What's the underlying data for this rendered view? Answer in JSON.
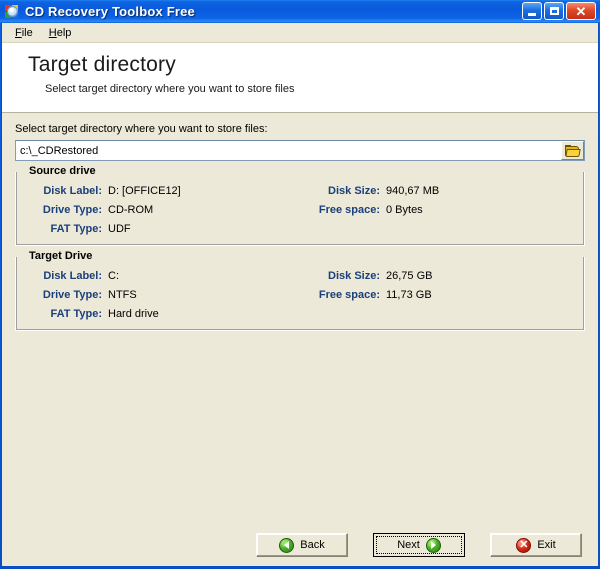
{
  "window": {
    "title": "CD Recovery Toolbox Free",
    "icon": "cd-disc-icon",
    "controls": {
      "minimize": "minimize-icon",
      "maximize": "maximize-icon",
      "close": "✕"
    }
  },
  "menu": {
    "items": [
      {
        "accel": "F",
        "rest": "ile"
      },
      {
        "accel": "H",
        "rest": "elp"
      }
    ]
  },
  "header": {
    "title": "Target directory",
    "subtitle": "Select target directory where you want to store files"
  },
  "path_field": {
    "label": "Select target directory where you want to store files:",
    "value": "c:\\_CDRestored",
    "placeholder": "",
    "browse_icon": "folder-open-icon"
  },
  "source_drive": {
    "title": "Source drive",
    "left": [
      {
        "key": "Disk Label:",
        "value": "D: [OFFICE12]"
      },
      {
        "key": "Drive Type:",
        "value": "CD-ROM"
      },
      {
        "key": "FAT Type:",
        "value": "UDF"
      }
    ],
    "right": [
      {
        "key": "Disk Size:",
        "value": "940,67 MB"
      },
      {
        "key": "Free space:",
        "value": "0 Bytes"
      }
    ]
  },
  "target_drive": {
    "title": "Target Drive",
    "left": [
      {
        "key": "Disk Label:",
        "value": "C:"
      },
      {
        "key": "Drive Type:",
        "value": "NTFS"
      },
      {
        "key": "FAT Type:",
        "value": "Hard drive"
      }
    ],
    "right": [
      {
        "key": "Disk Size:",
        "value": "26,75 GB"
      },
      {
        "key": "Free space:",
        "value": "11,73 GB"
      }
    ]
  },
  "buttons": {
    "back": "Back",
    "next": "Next",
    "exit": "Exit"
  },
  "colors": {
    "titlebar_blue": "#0a59dd",
    "client_beige": "#ece9d8",
    "label_navy": "#1b3f7a",
    "icon_green": "#4cb02a",
    "icon_red": "#d32b16",
    "folder_yellow": "#f7d33e"
  }
}
